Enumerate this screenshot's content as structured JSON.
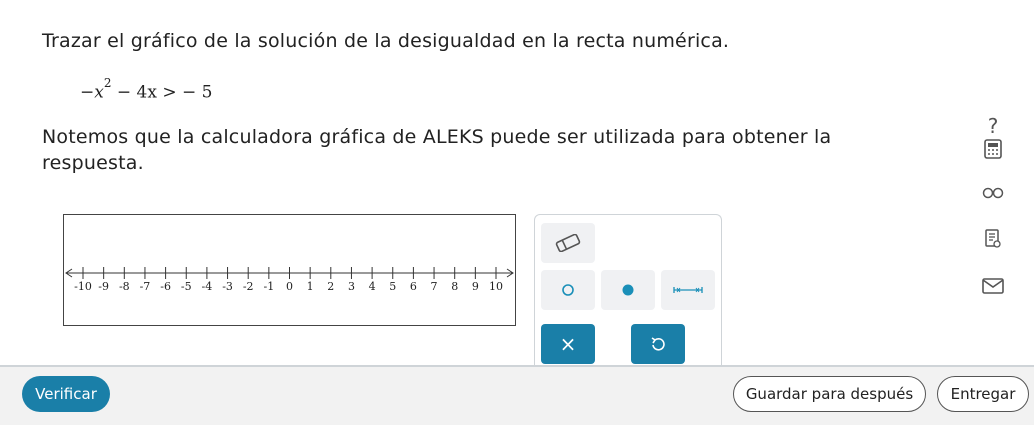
{
  "prompt": "Trazar el gráfico de la solución de la desigualdad en la recta numérica.",
  "inequality": {
    "neg": "−",
    "var": "x",
    "exp": "2",
    "rest": " − 4x > − 5"
  },
  "note": "Notemos que la calculadora gráfica de ALEKS puede ser utilizada para obtener la respuesta.",
  "number_line": {
    "ticks": [
      "-10",
      "-9",
      "-8",
      "-7",
      "-6",
      "-5",
      "-4",
      "-3",
      "-2",
      "-1",
      "0",
      "1",
      "2",
      "3",
      "4",
      "5",
      "6",
      "7",
      "8",
      "9",
      "10"
    ]
  },
  "side_icons": {
    "help": "?",
    "calculator": "calculator-icon",
    "glasses": "glasses-icon",
    "notes": "notes-icon",
    "mail": "mail-icon"
  },
  "tools": {
    "eraser": "eraser-icon",
    "open_point": "open-circle-icon",
    "closed_point": "closed-circle-icon",
    "segment": "segment-icon",
    "clear": "×",
    "undo": "undo-icon"
  },
  "buttons": {
    "verify": "Verificar",
    "save": "Guardar para después",
    "submit": "Entregar"
  },
  "colors": {
    "accent": "#1a7fa8"
  }
}
